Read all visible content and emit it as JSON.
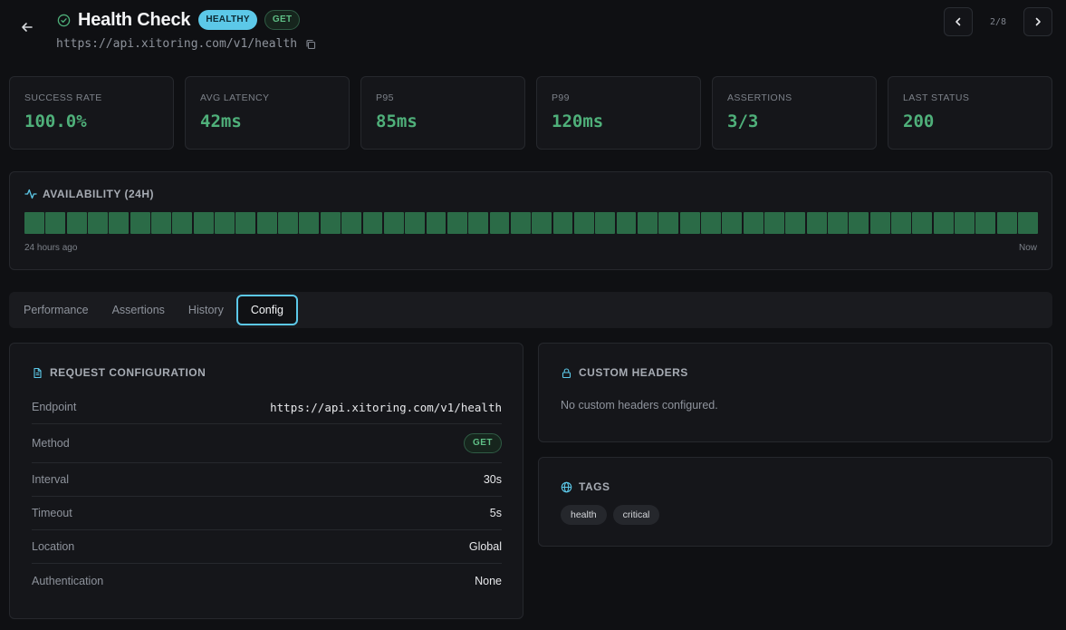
{
  "header": {
    "back_icon": "arrow-left-icon",
    "status_icon": "check-circle-icon",
    "title": "Health Check",
    "status_badge": "HEALTHY",
    "method_badge": "GET",
    "url": "https://api.xitoring.com/v1/health",
    "copy_icon": "copy-icon"
  },
  "pager": {
    "prev_icon": "chevron-left-icon",
    "next_icon": "chevron-right-icon",
    "position": "2/8"
  },
  "stats": [
    {
      "label": "SUCCESS RATE",
      "value": "100.0%"
    },
    {
      "label": "AVG LATENCY",
      "value": "42ms"
    },
    {
      "label": "P95",
      "value": "85ms"
    },
    {
      "label": "P99",
      "value": "120ms"
    },
    {
      "label": "ASSERTIONS",
      "value": "3/3"
    },
    {
      "label": "LAST STATUS",
      "value": "200"
    }
  ],
  "availability": {
    "icon": "activity-icon",
    "title": "AVAILABILITY (24H)",
    "start_label": "24 hours ago",
    "end_label": "Now",
    "bar_count": 48,
    "bar_color": "#2b6b47"
  },
  "tabs": [
    {
      "label": "Performance",
      "active": false
    },
    {
      "label": "Assertions",
      "active": false
    },
    {
      "label": "History",
      "active": false
    },
    {
      "label": "Config",
      "active": true
    }
  ],
  "request_config": {
    "icon": "document-icon",
    "title": "REQUEST CONFIGURATION",
    "rows": [
      {
        "key": "Endpoint",
        "value": "https://api.xitoring.com/v1/health"
      },
      {
        "key": "Method",
        "value": "GET"
      },
      {
        "key": "Interval",
        "value": "30s"
      },
      {
        "key": "Timeout",
        "value": "5s"
      },
      {
        "key": "Location",
        "value": "Global"
      },
      {
        "key": "Authentication",
        "value": "None"
      }
    ]
  },
  "custom_headers": {
    "icon": "lock-icon",
    "title": "CUSTOM HEADERS",
    "empty_text": "No custom headers configured."
  },
  "tags": {
    "icon": "globe-icon",
    "title": "TAGS",
    "items": [
      "health",
      "critical"
    ]
  },
  "colors": {
    "accent": "#5cc8e8",
    "success": "#4fb07a",
    "background": "#0f1013"
  }
}
